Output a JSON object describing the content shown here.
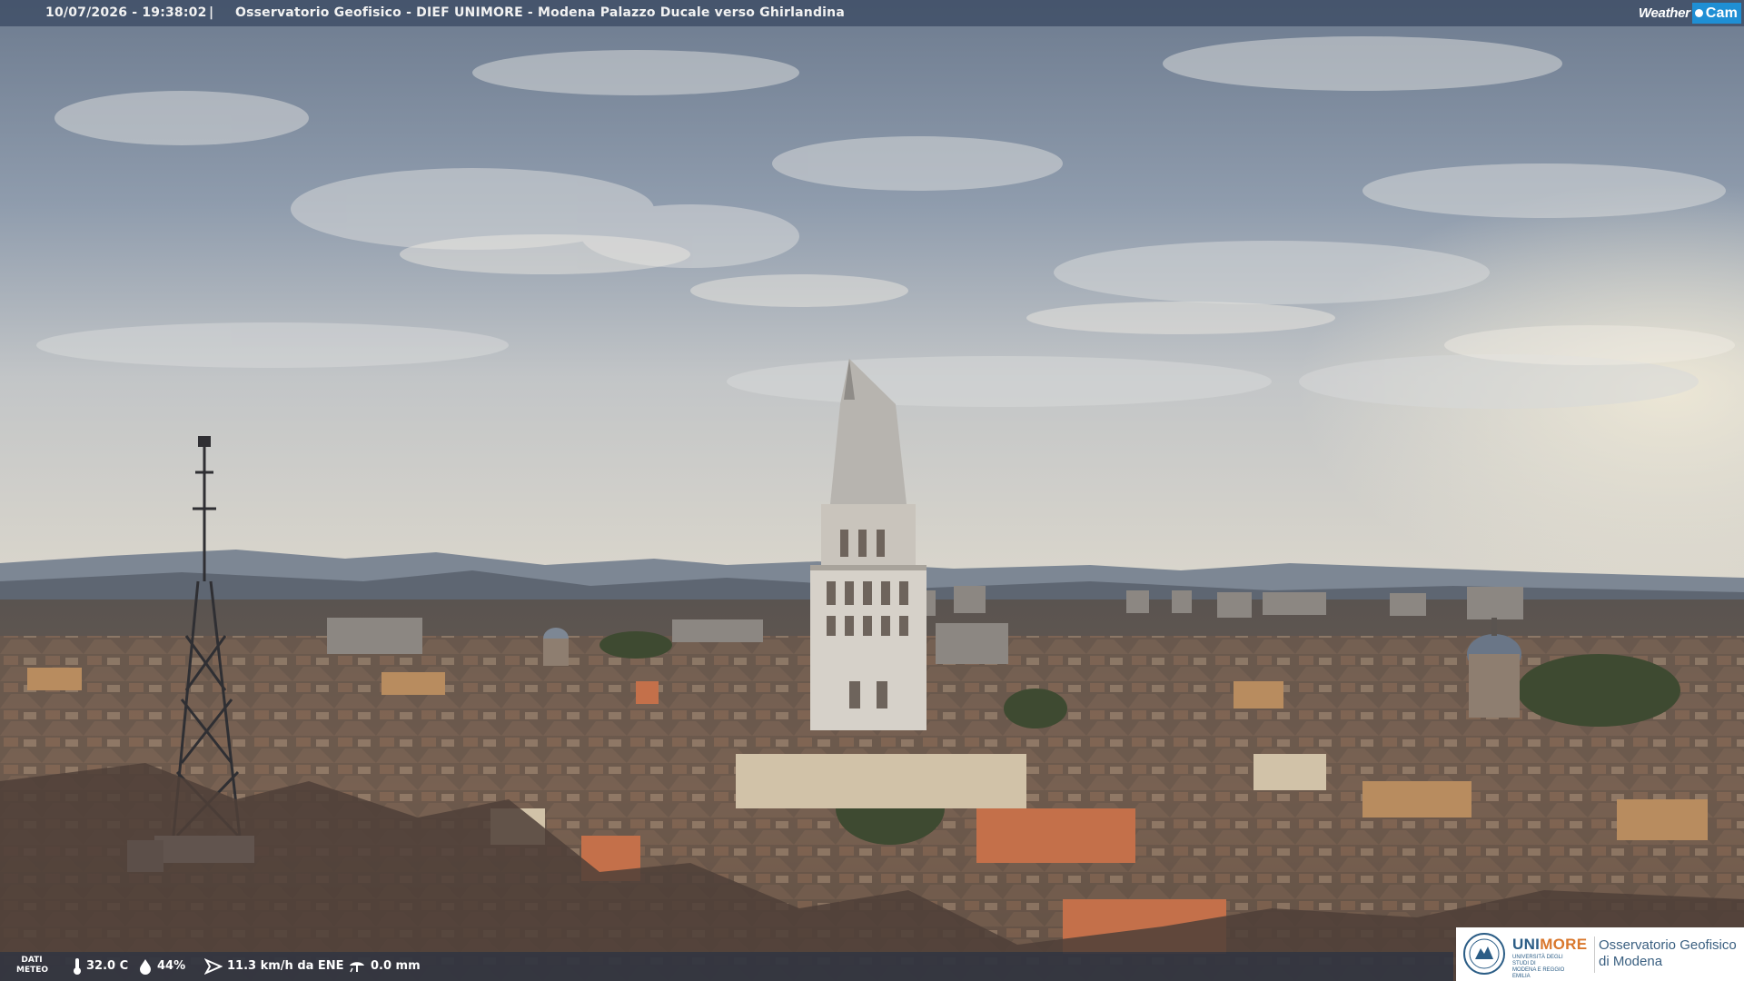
{
  "header": {
    "timestamp": "10/07/2026 - 19:38:02",
    "separator": "|",
    "title": "Osservatorio Geofisico - DIEF UNIMORE - Modena Palazzo Ducale verso Ghirlandina",
    "brand_left": "Weather",
    "brand_right": "Cam",
    "brand_color": "#1f8fd4"
  },
  "meteo": {
    "label_line1": "DATI",
    "label_line2": "METEO",
    "temperature": "32.0 C",
    "humidity": "44%",
    "wind": "11.3 km/h da ENE",
    "rain": "0.0 mm"
  },
  "logo": {
    "uni_part1": "UNI",
    "uni_part2": "MORE",
    "university_line1": "UNIVERSITÀ DEGLI STUDI DI",
    "university_line2": "MODENA E REGGIO EMILIA",
    "observatory_line1": "Osservatorio Geofisico",
    "observatory_line2": "di Modena",
    "color_blue": "#2b5d86",
    "color_orange": "#d9772c"
  }
}
